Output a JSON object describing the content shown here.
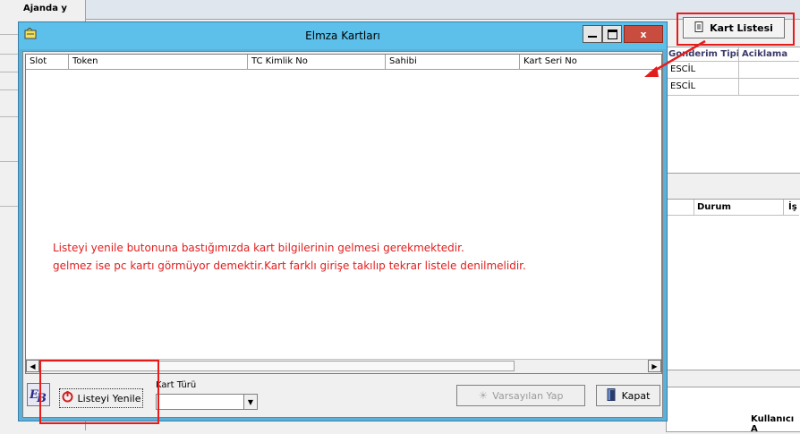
{
  "background": {
    "top_left_text": "Ajanda y",
    "grid_header": [
      "Gonderim Tipi",
      "Aciklama"
    ],
    "rows": [
      "ESCİL",
      "ESCİL"
    ],
    "lower_headers": [
      "Durum",
      "İş"
    ],
    "bottom_headers": [
      "Kullanıcı A"
    ]
  },
  "toolbar": {
    "kart_listesi_label": "Kart Listesi"
  },
  "dialog": {
    "title": "Elmza Kartları",
    "columns": [
      "Slot",
      "Token",
      "TC Kimlik No",
      "Sahibi",
      "Kart Seri No"
    ],
    "note_line1": "Listeyi yenile  butonuna bastığımızda kart bilgilerinin gelmesi gerekmektedir.",
    "note_line2": "gelmez ise pc kartı görmüyor demektir.Kart farklı girişe takılıp tekrar listele denilmelidir.",
    "refresh_label": "Listeyi Yenile",
    "card_type_label": "Kart Türü",
    "card_type_value": "",
    "default_label": "Varsayılan Yap",
    "close_label": "Kapat"
  },
  "colors": {
    "annotation": "#e21d1d",
    "titlebar": "#5cc0ea",
    "close": "#c94d3f"
  }
}
